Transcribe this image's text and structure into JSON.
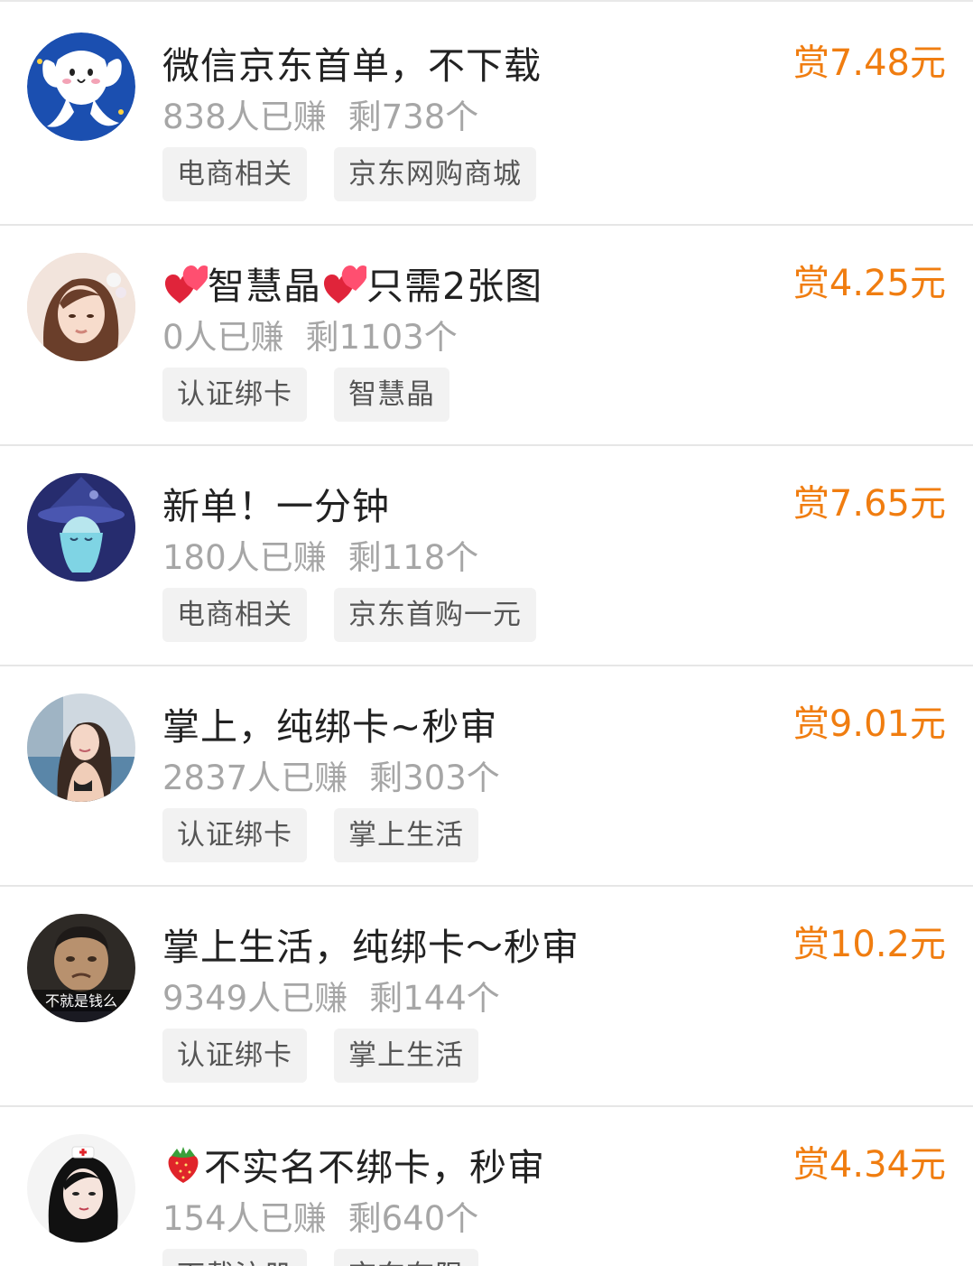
{
  "colors": {
    "reward": "#f07d10",
    "title": "#222222",
    "stats": "#a6a6a6",
    "tag_bg": "#f2f2f2",
    "tag_text": "#555555",
    "divider": "#e6e6e6"
  },
  "tasks": [
    {
      "title": "微信京东首单，不下载",
      "title_emoji": null,
      "earned": "838人已赚",
      "remaining": "剩738个",
      "reward": "赏7.48元",
      "tags": [
        "电商相关",
        "京东网购商城"
      ],
      "avatar_icon": "cartoon-character-avatar"
    },
    {
      "title": "智慧晶",
      "title_prefix_emoji": "heart-emoji",
      "title_mid_emoji": "heart-emoji",
      "title_suffix": "只需2张图",
      "earned": "0人已赚",
      "remaining": "剩1103个",
      "reward": "赏4.25元",
      "tags": [
        "认证绑卡",
        "智慧晶"
      ],
      "avatar_icon": "girl-photo-avatar"
    },
    {
      "title": "新单！一分钟",
      "earned": "180人已赚",
      "remaining": "剩118个",
      "reward": "赏7.65元",
      "tags": [
        "电商相关",
        "京东首购一元"
      ],
      "avatar_icon": "witch-character-avatar"
    },
    {
      "title": "掌上，纯绑卡~秒审",
      "earned": "2837人已赚",
      "remaining": "剩303个",
      "reward": "赏9.01元",
      "tags": [
        "认证绑卡",
        "掌上生活"
      ],
      "avatar_icon": "woman-photo-avatar"
    },
    {
      "title": "掌上生活，纯绑卡～秒审",
      "earned": "9349人已赚",
      "remaining": "剩144个",
      "reward": "赏10.2元",
      "tags": [
        "认证绑卡",
        "掌上生活"
      ],
      "avatar_icon": "man-photo-avatar",
      "avatar_caption": "不就是钱么"
    },
    {
      "title": "不实名不绑卡，秒审",
      "title_prefix_emoji": "strawberry-emoji",
      "earned": "154人已赚",
      "remaining": "剩640个",
      "reward": "赏4.34元",
      "tags": [
        "下载注册",
        "京东有限"
      ],
      "avatar_icon": "nurse-photo-avatar"
    }
  ]
}
